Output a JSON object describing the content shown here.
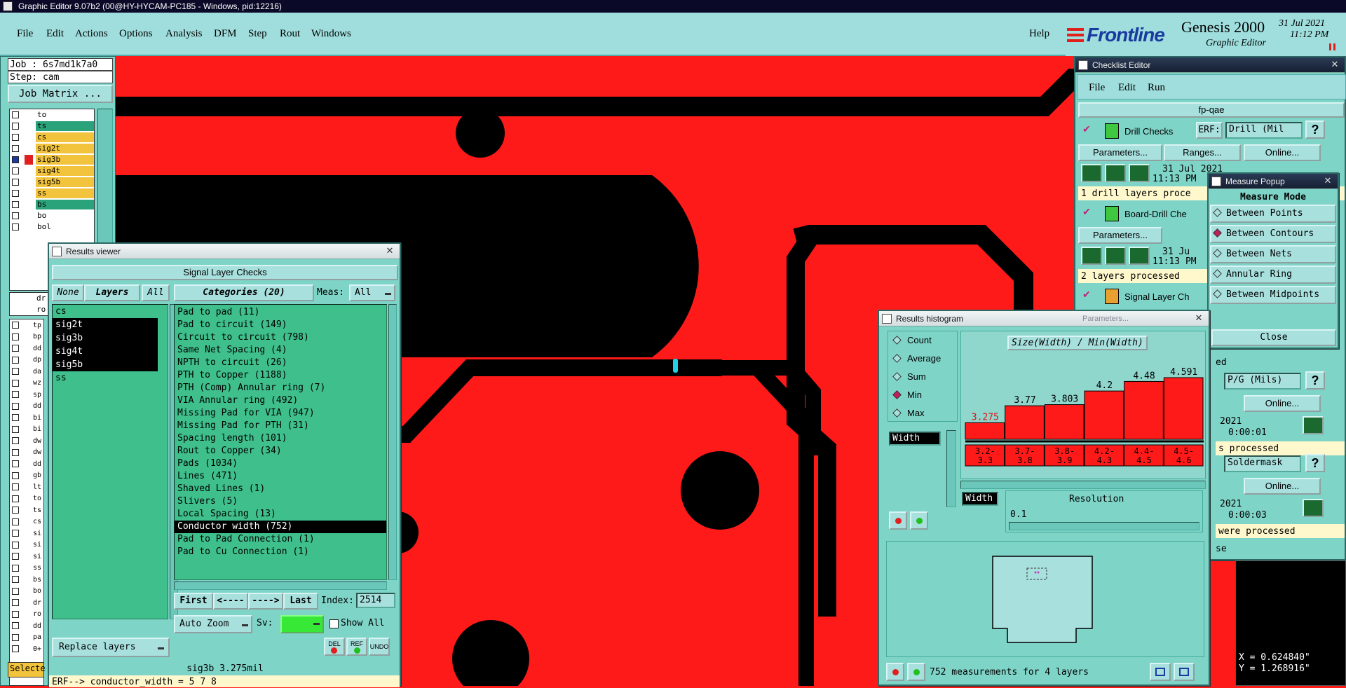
{
  "title_bar": "Graphic Editor 9.07b2 (00@HY-HYCAM-PC185 - Windows, pid:12216)",
  "menu": [
    "File",
    "Edit",
    "Actions",
    "Options",
    "Analysis",
    "DFM",
    "Step",
    "Rout",
    "Windows"
  ],
  "help_label": "Help",
  "brand": {
    "name": "Frontline",
    "product": "Genesis 2000",
    "subtitle": "Graphic Editor",
    "date": "31 Jul 2021",
    "time": "11:12 PM"
  },
  "job": {
    "job_label": "Job : 6s7md1k7a0",
    "step_label": "Step: cam",
    "matrix_button": "Job Matrix ..."
  },
  "layers": [
    {
      "name": "to",
      "color": "#ffffff"
    },
    {
      "name": "ts",
      "color": "#2ba37a"
    },
    {
      "name": "cs",
      "color": "#f2c43d"
    },
    {
      "name": "sig2t",
      "color": "#f2c43d"
    },
    {
      "name": "sig3b",
      "color": "#f2c43d",
      "active": true
    },
    {
      "name": "sig4t",
      "color": "#f2c43d"
    },
    {
      "name": "sig5b",
      "color": "#f2c43d"
    },
    {
      "name": "ss",
      "color": "#f2c43d"
    },
    {
      "name": "bs",
      "color": "#2ba37a"
    },
    {
      "name": "bo",
      "color": "#ffffff"
    },
    {
      "name": "bol",
      "color": "#ffffff"
    }
  ],
  "layers2": [
    "dr",
    "ro"
  ],
  "layers3": [
    "tp",
    "bp",
    "dd",
    "dp",
    "da",
    "wz",
    "sp",
    "dd",
    "bi",
    "bi",
    "dw",
    "dw",
    "dd",
    "gb",
    "lt",
    "to",
    "ts",
    "cs",
    "si",
    "si",
    "si",
    "ss",
    "bs",
    "bo",
    "dr",
    "ro",
    "dd",
    "pa",
    "0+"
  ],
  "selected_label": "Selecte",
  "results_viewer": {
    "title": "Results viewer",
    "header": "Signal Layer Checks",
    "none_btn": "None",
    "layers_btn": "Layers",
    "all_btn": "All",
    "categories_btn": "Categories (20)",
    "meas_label": "Meas:",
    "meas_value": "All",
    "layers": [
      {
        "name": "cs",
        "sel": false
      },
      {
        "name": "sig2t",
        "sel": true
      },
      {
        "name": "sig3b",
        "sel": true
      },
      {
        "name": "sig4t",
        "sel": true
      },
      {
        "name": "sig5b",
        "sel": true
      },
      {
        "name": "ss",
        "sel": false
      }
    ],
    "categories": [
      {
        "name": "Pad to pad (11)",
        "sel": false
      },
      {
        "name": "Pad to circuit (149)",
        "sel": false
      },
      {
        "name": "Circuit to circuit (798)",
        "sel": false
      },
      {
        "name": "Same Net Spacing (4)",
        "sel": false
      },
      {
        "name": "NPTH to circuit (26)",
        "sel": false
      },
      {
        "name": "PTH to Copper (1188)",
        "sel": false
      },
      {
        "name": "PTH (Comp) Annular ring (7)",
        "sel": false
      },
      {
        "name": "VIA Annular ring (492)",
        "sel": false
      },
      {
        "name": "Missing Pad for VIA (947)",
        "sel": false
      },
      {
        "name": "Missing Pad for PTH (31)",
        "sel": false
      },
      {
        "name": "Spacing length (101)",
        "sel": false
      },
      {
        "name": "Rout to Copper (34)",
        "sel": false
      },
      {
        "name": "Pads (1034)",
        "sel": false
      },
      {
        "name": "Lines (471)",
        "sel": false
      },
      {
        "name": "Shaved Lines (1)",
        "sel": false
      },
      {
        "name": "Slivers (5)",
        "sel": false
      },
      {
        "name": "Local Spacing (13)",
        "sel": false
      },
      {
        "name": "Conductor width (752)",
        "sel": true
      },
      {
        "name": "Pad to Pad Connection (1)",
        "sel": false
      },
      {
        "name": "Pad to Cu Connection (1)",
        "sel": false
      }
    ],
    "first_btn": "First",
    "prev_btn": "<----",
    "next_btn": "---->",
    "last_btn": "Last",
    "index_label": "Index:",
    "index_value": "2514",
    "auto_zoom": "Auto Zoom",
    "sv_label": "Sv:",
    "show_all": "Show All",
    "replace_layers": "Replace layers",
    "del_label": "DEL",
    "ref_label": "REF",
    "undo_label": "UNDO",
    "status": "sig3b 3.275mil",
    "erf_line": "ERF--> conductor_width = 5 7 8"
  },
  "checklist": {
    "title": "Checklist Editor",
    "menu": [
      "File",
      "Edit",
      "Run"
    ],
    "name": "fp-qae",
    "erf_label": "ERF:",
    "drill": {
      "name": "Drill Checks",
      "erf": "Drill (Mil",
      "date": "31 Jul 2021",
      "time": "11:13 PM",
      "status": "1 drill layers proce"
    },
    "board": {
      "name": "Board-Drill Che",
      "date": "31 Ju",
      "time": "11:13 PM",
      "status": "2 layers processed"
    },
    "signal": {
      "name": "Signal Layer Ch"
    },
    "params_btn": "Parameters...",
    "ranges_btn": "Ranges...",
    "online_btn": "Online...",
    "right_col": {
      "ed": "ed",
      "pg": "P/G (Mils)",
      "online1": "Online...",
      "d1": "2021",
      "t1": "0:00:01",
      "p1": "s processed",
      "sm": "Soldermask",
      "online2": "Online...",
      "d2": "2021",
      "t2": "0:00:03",
      "p2": "were processed",
      "se": "se"
    }
  },
  "measure": {
    "title": "Measure Popup",
    "mode_label": "Measure Mode",
    "options": [
      {
        "name": "Between Points",
        "sel": false
      },
      {
        "name": "Between Contours",
        "sel": true
      },
      {
        "name": "Between Nets",
        "sel": false
      },
      {
        "name": "Annular Ring",
        "sel": false
      },
      {
        "name": "Between Midpoints",
        "sel": false
      }
    ],
    "close": "Close"
  },
  "histogram": {
    "title": "Results histogram",
    "faded": "Parameters...",
    "modes": [
      {
        "name": "Count",
        "sel": false
      },
      {
        "name": "Average",
        "sel": false
      },
      {
        "name": "Sum",
        "sel": false
      },
      {
        "name": "Min",
        "sel": true
      },
      {
        "name": "Max",
        "sel": false
      }
    ],
    "field": "Width",
    "chart_title": "Size(Width) / Min(Width)",
    "resolution_label": "Resolution",
    "resolution_value": "0.1",
    "footer": "752 measurements for 4 layers"
  },
  "chart_data": {
    "type": "bar",
    "title": "Size(Width) / Min(Width)",
    "categories": [
      "3.2-3.3",
      "3.7-3.8",
      "3.8-3.9",
      "4.2-4.3",
      "4.4-4.5",
      "4.5-4.6"
    ],
    "category_labels": [
      [
        "3.2-",
        "3.3"
      ],
      [
        "3.7-",
        "3.8"
      ],
      [
        "3.8-",
        "3.9"
      ],
      [
        "4.2-",
        "4.3"
      ],
      [
        "4.4-",
        "4.5"
      ],
      [
        "4.5-",
        "4.6"
      ]
    ],
    "values": [
      3.275,
      3.77,
      3.803,
      4.2,
      4.48,
      4.591
    ],
    "value_labels": [
      "3.275",
      "3.77",
      "3.803",
      "4.2",
      "4.48",
      "4.591"
    ],
    "highlight_index": 0,
    "bar_color": "#ff1a1a"
  },
  "coords": {
    "x": "X = 0.624840\"",
    "y": "Y = 1.268916\""
  },
  "colors": {
    "copper": "#ff1a1a",
    "panel": "#7fd4c8",
    "list": "#3fbf8c",
    "menubar": "#9fdedd"
  }
}
